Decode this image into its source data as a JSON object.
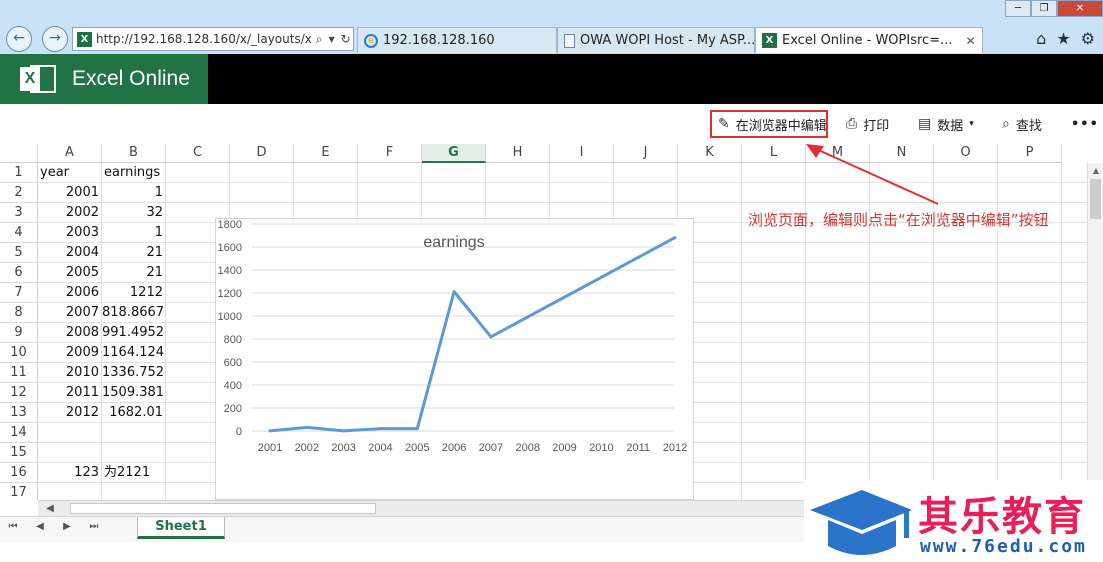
{
  "browser": {
    "window_buttons": [
      "─",
      "❐",
      "✕"
    ],
    "address": "http://192.168.128.160/x/_layouts/x",
    "tabs": [
      {
        "title": "192.168.128.160"
      },
      {
        "title": "OWA WOPI Host - My ASP..."
      },
      {
        "title": "Excel Online - WOPIsrc=..."
      }
    ]
  },
  "app": {
    "name": "Excel Online",
    "accent": "#217346"
  },
  "commands": {
    "edit": "在浏览器中编辑",
    "print": "打印",
    "data": "数据",
    "find": "查找",
    "more": "•••"
  },
  "grid": {
    "columns": [
      "A",
      "B",
      "C",
      "D",
      "E",
      "F",
      "G",
      "H",
      "I",
      "J",
      "K",
      "L",
      "M",
      "N",
      "O",
      "P"
    ],
    "selected_column": "G",
    "row_numbers": [
      "1",
      "2",
      "3",
      "4",
      "5",
      "6",
      "7",
      "8",
      "9",
      "10",
      "11",
      "12",
      "13",
      "14",
      "15",
      "16",
      "17"
    ],
    "header": {
      "a": "year",
      "b": "earnings"
    },
    "rows": [
      {
        "a": "2001",
        "b": "1"
      },
      {
        "a": "2002",
        "b": "32"
      },
      {
        "a": "2003",
        "b": "1"
      },
      {
        "a": "2004",
        "b": "21"
      },
      {
        "a": "2005",
        "b": "21"
      },
      {
        "a": "2006",
        "b": "1212"
      },
      {
        "a": "2007",
        "b": "818.8667"
      },
      {
        "a": "2008",
        "b": "991.4952"
      },
      {
        "a": "2009",
        "b": "1164.124"
      },
      {
        "a": "2010",
        "b": "1336.752"
      },
      {
        "a": "2011",
        "b": "1509.381"
      },
      {
        "a": "2012",
        "b": "1682.01"
      }
    ],
    "row16": {
      "a": "123",
      "b": "为2121"
    }
  },
  "chart_data": {
    "type": "line",
    "title": "earnings",
    "categories": [
      "2001",
      "2002",
      "2003",
      "2004",
      "2005",
      "2006",
      "2007",
      "2008",
      "2009",
      "2010",
      "2011",
      "2012"
    ],
    "series": [
      {
        "values": [
          1,
          32,
          1,
          21,
          21,
          1212,
          818.8667,
          991.4952,
          1164.124,
          1336.752,
          1509.381,
          1682.01
        ],
        "color": "#5b9bd5"
      }
    ],
    "yticks": [
      0,
      200,
      400,
      600,
      800,
      1000,
      1200,
      1400,
      1600,
      1800
    ],
    "ylim": [
      0,
      1800
    ],
    "grid": true,
    "legend": "none"
  },
  "annotation": {
    "text": "浏览页面，编辑则点击“在浏览器中编辑”按钮",
    "color": "#e03131"
  },
  "sheets": {
    "tabs": [
      "Sheet1"
    ],
    "nav": [
      "⏮",
      "◀",
      "▶",
      "⏭"
    ]
  },
  "watermark": {
    "title": "其乐教育",
    "url": "www.76edu.com"
  }
}
